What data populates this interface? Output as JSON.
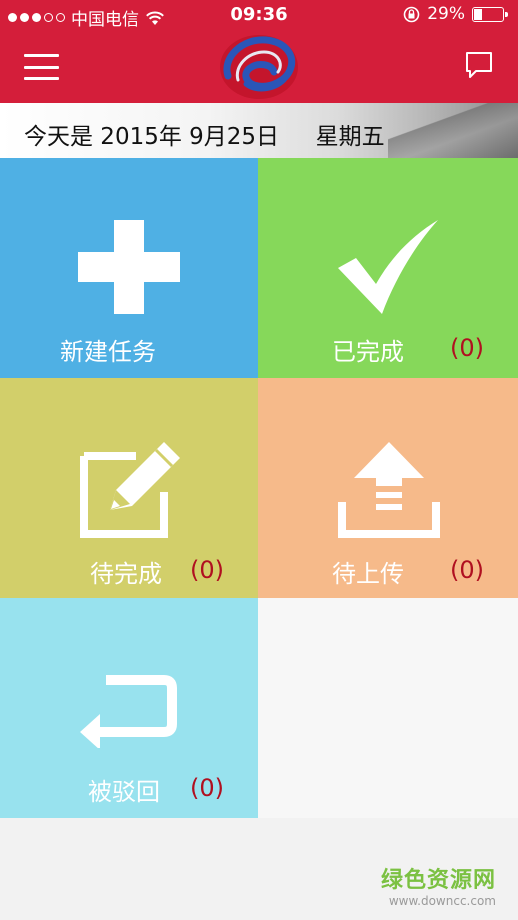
{
  "status_bar": {
    "carrier": "中国电信",
    "time": "09:36",
    "battery_percent": "29%",
    "battery_level": 0.29
  },
  "nav": {
    "menu_icon": "hamburger-icon",
    "message_icon": "chat-bubble-icon",
    "brand_colors": {
      "bar": "#d41e3a",
      "logo_blue": "#2a56b8",
      "logo_red": "#e02030"
    }
  },
  "date_banner": {
    "text": "今天是 2015年 9月25日     星期五"
  },
  "tiles": {
    "new_task": {
      "label": "新建任务",
      "icon": "plus-icon",
      "color": "#4fb0e4"
    },
    "completed": {
      "label": "已完成",
      "count": "(0)",
      "icon": "checkmark-icon",
      "color": "#86d85a"
    },
    "pending": {
      "label": "待完成",
      "count": "(0)",
      "icon": "edit-icon",
      "color": "#d2cf6a"
    },
    "to_upload": {
      "label": "待上传",
      "count": "(0)",
      "icon": "upload-icon",
      "color": "#f6ba8a"
    },
    "rejected": {
      "label": "被驳回",
      "count": "(0)",
      "icon": "return-arrow-icon",
      "color": "#98e2ee"
    }
  },
  "watermark": {
    "title": "绿色资源网",
    "url": "www.downcc.com"
  }
}
